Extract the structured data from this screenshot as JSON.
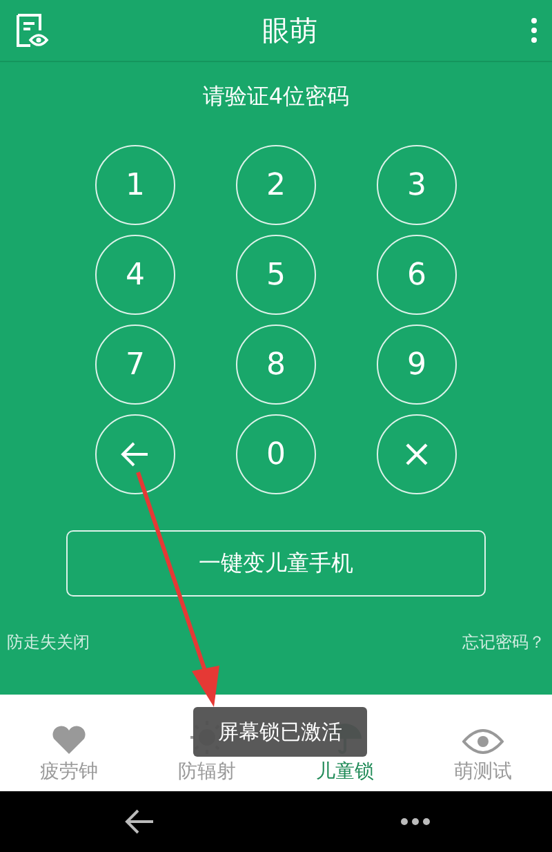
{
  "app_bar": {
    "title": "眼萌"
  },
  "prompt": "请验证4位密码",
  "keypad": [
    {
      "kind": "digit",
      "label": "1"
    },
    {
      "kind": "digit",
      "label": "2"
    },
    {
      "kind": "digit",
      "label": "3"
    },
    {
      "kind": "digit",
      "label": "4"
    },
    {
      "kind": "digit",
      "label": "5"
    },
    {
      "kind": "digit",
      "label": "6"
    },
    {
      "kind": "digit",
      "label": "7"
    },
    {
      "kind": "digit",
      "label": "8"
    },
    {
      "kind": "digit",
      "label": "9"
    },
    {
      "kind": "backspace"
    },
    {
      "kind": "digit",
      "label": "0"
    },
    {
      "kind": "clear"
    }
  ],
  "child_phone_button": "一键变儿童手机",
  "links": {
    "left": "防走失关闭",
    "right": "忘记密码？"
  },
  "tabs": [
    {
      "kind": "heart",
      "label": "疲劳钟",
      "selected": false
    },
    {
      "kind": "sun",
      "label": "防辐射",
      "selected": false
    },
    {
      "kind": "umbrella",
      "label": "儿童锁",
      "selected": true
    },
    {
      "kind": "eye",
      "label": "萌测试",
      "selected": false
    }
  ],
  "toast": "屏幕锁已激活"
}
